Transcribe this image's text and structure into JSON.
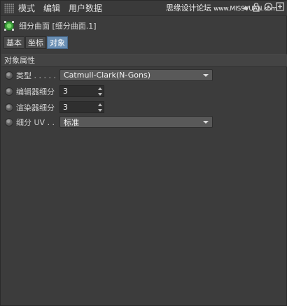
{
  "menubar": {
    "items": [
      "模式",
      "编辑",
      "用户数据"
    ],
    "watermark_main": "思缘设计论坛",
    "watermark_small": "www.MISSVUAN.com"
  },
  "object": {
    "title": "细分曲面 [细分曲面.1]"
  },
  "tabs": [
    "基本",
    "坐标",
    "对象"
  ],
  "section": {
    "title": "对象属性"
  },
  "fields": {
    "type": {
      "label": "类型 . . . . .",
      "value": "Catmull-Clark(N-Gons)"
    },
    "editor_subdiv": {
      "label": "编辑器细分",
      "value": "3"
    },
    "render_subdiv": {
      "label": "渲染器细分",
      "value": "3"
    },
    "subdiv_uv": {
      "label": "细分 UV . .",
      "value": "标准"
    }
  },
  "colors": {
    "background": "#3c3c3c",
    "active_tab": "#6a8fb4"
  }
}
